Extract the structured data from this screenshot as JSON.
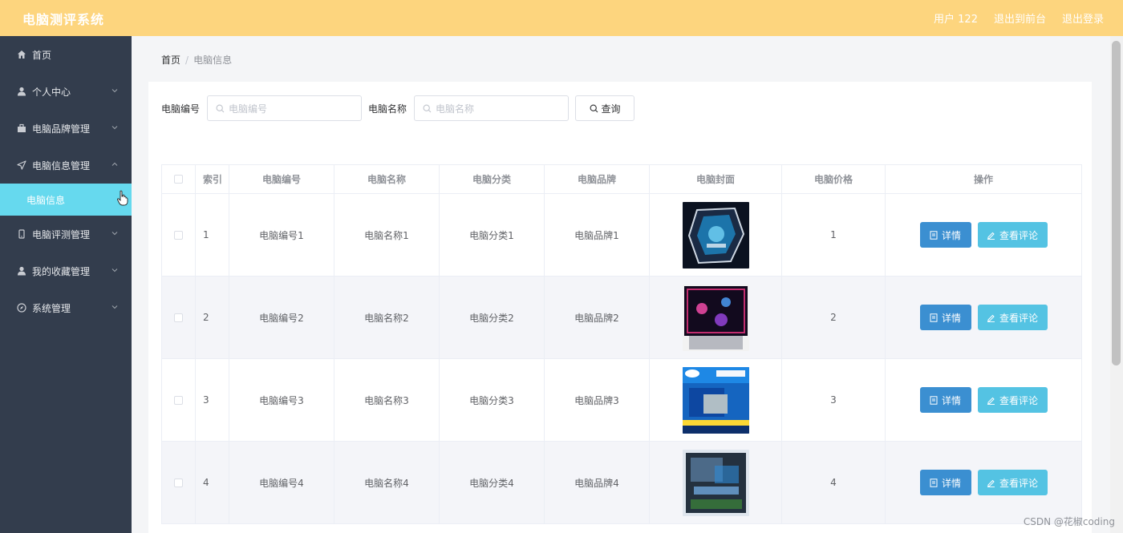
{
  "header": {
    "title": "电脑测评系统",
    "user": "用户 122",
    "to_front": "退出到前台",
    "logout": "退出登录"
  },
  "sidebar": {
    "items": [
      {
        "label": "首页",
        "icon": "home-icon",
        "has_children": false
      },
      {
        "label": "个人中心",
        "icon": "user-icon",
        "has_children": true
      },
      {
        "label": "电脑品牌管理",
        "icon": "folder-icon",
        "has_children": true
      },
      {
        "label": "电脑信息管理",
        "icon": "send-icon",
        "has_children": true,
        "expanded": true
      },
      {
        "label": "电脑评测管理",
        "icon": "phone-icon",
        "has_children": true
      },
      {
        "label": "我的收藏管理",
        "icon": "user-icon",
        "has_children": true
      },
      {
        "label": "系统管理",
        "icon": "compass-icon",
        "has_children": true
      }
    ],
    "active_sub": "电脑信息"
  },
  "breadcrumb": {
    "home": "首页",
    "sep": "/",
    "current": "电脑信息"
  },
  "search": {
    "code_label": "电脑编号",
    "code_placeholder": "电脑编号",
    "name_label": "电脑名称",
    "name_placeholder": "电脑名称",
    "query_button": "查询"
  },
  "table": {
    "headers": [
      "索引",
      "电脑编号",
      "电脑名称",
      "电脑分类",
      "电脑品牌",
      "电脑封面",
      "电脑价格",
      "操作"
    ],
    "rows": [
      {
        "index": "1",
        "code": "电脑编号1",
        "name": "电脑名称1",
        "category": "电脑分类1",
        "brand": "电脑品牌1",
        "price": "1"
      },
      {
        "index": "2",
        "code": "电脑编号2",
        "name": "电脑名称2",
        "category": "电脑分类2",
        "brand": "电脑品牌2",
        "price": "2"
      },
      {
        "index": "3",
        "code": "电脑编号3",
        "name": "电脑名称3",
        "category": "电脑分类3",
        "brand": "电脑品牌3",
        "price": "3"
      },
      {
        "index": "4",
        "code": "电脑编号4",
        "name": "电脑名称4",
        "category": "电脑分类4",
        "brand": "电脑品牌4",
        "price": "4"
      }
    ],
    "detail_label": "详情",
    "review_label": "查看评论"
  },
  "colors": {
    "header_bg": "#fdd57e",
    "sidebar_bg": "#333d4d",
    "active_sub_bg": "#66d9ee",
    "detail_btn": "#3b8fd1",
    "review_btn": "#54c3e3"
  },
  "watermark": "CSDN @花椒coding"
}
